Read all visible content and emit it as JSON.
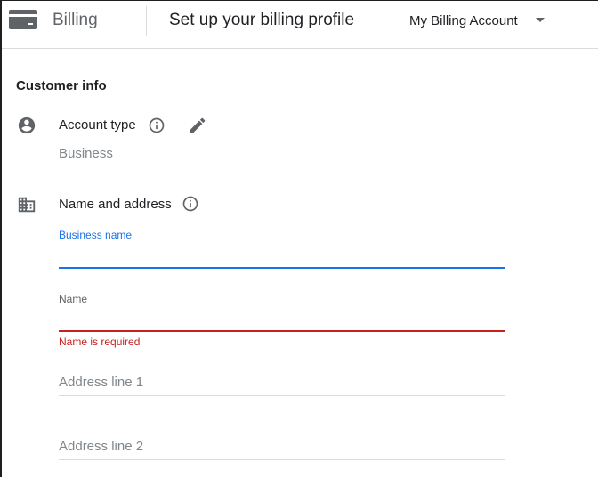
{
  "header": {
    "app_name": "Billing",
    "page_title": "Set up your billing profile",
    "account_selector": "My Billing Account"
  },
  "customer_info": {
    "section_title": "Customer info",
    "account_type": {
      "label": "Account type",
      "value": "Business"
    },
    "name_and_address": {
      "label": "Name and address"
    }
  },
  "form": {
    "business_name": {
      "label": "Business name",
      "value": ""
    },
    "name": {
      "label": "Name",
      "value": "",
      "error": "Name is required"
    },
    "address_line_1": {
      "placeholder": "Address line 1",
      "value": ""
    },
    "address_line_2": {
      "placeholder": "Address line 2",
      "value": ""
    }
  },
  "colors": {
    "focus_blue": "#1a73e8",
    "error_red": "#c5221f",
    "text_primary": "#202124",
    "text_secondary": "#5f6368",
    "text_hint": "#80868b",
    "divider": "#dadce0"
  },
  "icons": {
    "app": "credit-card-icon",
    "account_type": "account-circle-icon",
    "name_and_address": "business-building-icon",
    "info": "info-outline-icon",
    "edit": "pencil-icon",
    "dropdown": "caret-down-icon"
  }
}
